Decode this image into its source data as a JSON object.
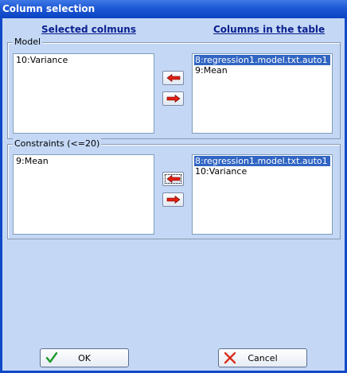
{
  "window": {
    "title": "Column selection"
  },
  "headers": {
    "selected": "Selected colmuns",
    "available": "Columns in the table"
  },
  "model": {
    "label": "Model",
    "selected_items": [
      "10:Variance"
    ],
    "available_items": [
      {
        "text": "8:regression1.model.txt.auto1",
        "selected": true
      },
      {
        "text": "9:Mean",
        "selected": false
      }
    ]
  },
  "constraints": {
    "label": "Constraints (<=20)",
    "selected_items": [
      "9:Mean"
    ],
    "available_items": [
      {
        "text": "8:regression1.model.txt.auto1",
        "selected": true
      },
      {
        "text": "10:Variance",
        "selected": false
      }
    ]
  },
  "buttons": {
    "ok": "OK",
    "cancel": "Cancel"
  },
  "icons": {
    "add": "left-arrow-icon",
    "remove": "right-arrow-icon",
    "ok": "check-icon",
    "cancel": "x-icon"
  },
  "colors": {
    "title_bar": "#1d58d5",
    "selection": "#3165c3",
    "arrow": "#e02010"
  }
}
